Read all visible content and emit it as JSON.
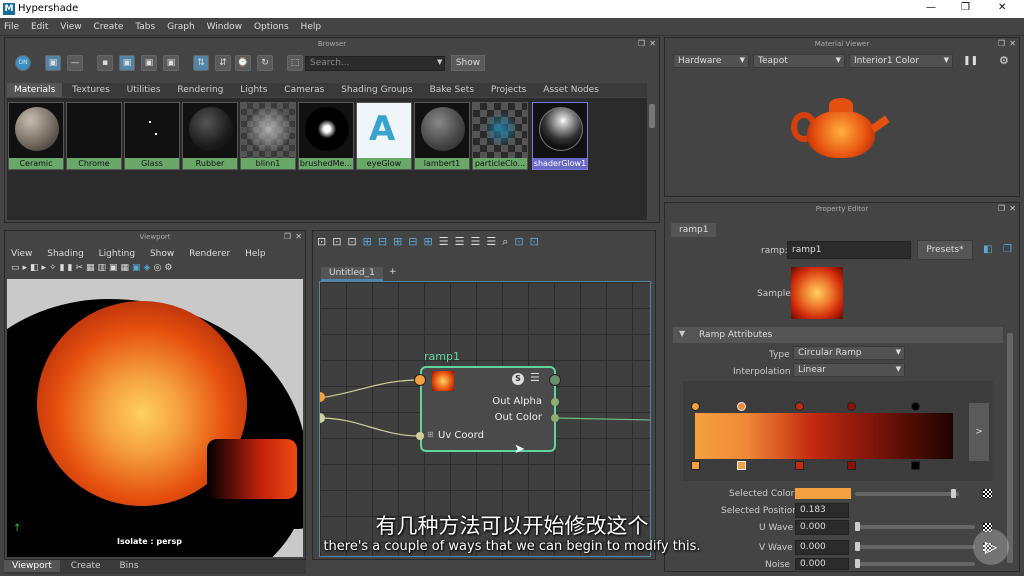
{
  "window": {
    "title": "Hypershade",
    "min": "—",
    "max": "❐",
    "close": "✕"
  },
  "menu": [
    "File",
    "Edit",
    "View",
    "Create",
    "Tabs",
    "Graph",
    "Window",
    "Options",
    "Help"
  ],
  "browser": {
    "title": "Browser",
    "search_placeholder": "Search...",
    "show": "Show",
    "tabs": [
      "Materials",
      "Textures",
      "Utilities",
      "Rendering",
      "Lights",
      "Cameras",
      "Shading Groups",
      "Bake Sets",
      "Projects",
      "Asset Nodes"
    ],
    "materials": [
      {
        "name": "Ceramic",
        "color": "#8a8178"
      },
      {
        "name": "Chrome",
        "color": "#000000"
      },
      {
        "name": "Glass",
        "color": "#000000"
      },
      {
        "name": "Rubber",
        "color": "#222222"
      },
      {
        "name": "blinn1",
        "color": "#666666"
      },
      {
        "name": "brushedMe...",
        "color": "#000000"
      },
      {
        "name": "eyeGlow",
        "color": "#ffffff"
      },
      {
        "name": "lambert1",
        "color": "#555555"
      },
      {
        "name": "particleClo...",
        "color": "#444444"
      },
      {
        "name": "shaderGlow1",
        "color": "#333333"
      }
    ]
  },
  "viewport": {
    "title": "Viewport",
    "menus": [
      "View",
      "Shading",
      "Lighting",
      "Show",
      "Renderer",
      "Help"
    ],
    "camera": "Isolate : persp"
  },
  "graph": {
    "tab": "Untitled_1",
    "plus": "+",
    "node": {
      "name": "ramp1",
      "out_alpha": "Out Alpha",
      "out_color": "Out Color",
      "uv_coord": "Uv Coord",
      "s": "S"
    }
  },
  "material_viewer": {
    "title": "Material Viewer",
    "renderer": "Hardware",
    "shape": "Teapot",
    "shader": "Interior1 Color"
  },
  "property_editor": {
    "title": "Property Editor",
    "tab": "ramp1",
    "ramp_label": "ramp:",
    "ramp_value": "ramp1",
    "presets": "Presets*",
    "sample": "Sample",
    "section": "Ramp Attributes",
    "type_label": "Type",
    "type_value": "Circular Ramp",
    "interp_label": "Interpolation",
    "interp_value": "Linear",
    "arrow": ">",
    "selected_color_label": "Selected Color",
    "selected_pos_label": "Selected Position",
    "selected_pos_value": "0.183",
    "uwave_label": "U Wave",
    "uwave_value": "0.000",
    "vwave_label": "V Wave",
    "vwave_value": "0.000",
    "noise_label": "Noise",
    "noise_value": "0.000"
  },
  "bottom_tabs": [
    "Viewport",
    "Create",
    "Bins"
  ],
  "subtitle": {
    "zh": "有几种方法可以开始修改这个",
    "en": "there's a couple of ways that we can begin to modify this."
  },
  "colors": {
    "accent": "#5285a6",
    "ramp_orange": "#f5a040",
    "node_border": "#5fd4a0"
  }
}
